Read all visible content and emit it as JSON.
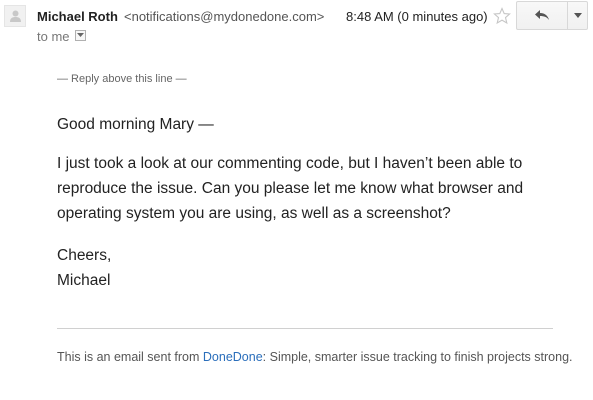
{
  "header": {
    "sender_name": "Michael Roth",
    "sender_email": "<notifications@mydonedone.com>",
    "timestamp": "8:48 AM (0 minutes ago)",
    "recipient_label": "to me"
  },
  "body": {
    "reply_marker": "— Reply above this line —",
    "greeting": "Good morning Mary —",
    "paragraph_lines": [
      "I just took a look at our commenting code, but I haven’t been able to",
      "reproduce the issue. Can you please let me know what browser and",
      "operating system you are using, as well as a screenshot?"
    ],
    "signoff_lines": [
      "Cheers,",
      "Michael"
    ]
  },
  "footer": {
    "prefix": "This is an email sent from ",
    "link_text": "DoneDone",
    "suffix": ": Simple, smarter issue tracking to finish projects strong."
  },
  "icons": {
    "avatar": "person-icon",
    "star": "star-icon",
    "reply": "reply-arrow-icon",
    "more": "chevron-down-icon",
    "details": "dropdown-toggle-icon"
  },
  "colors": {
    "link": "#2a6ebb",
    "star_outline": "#c6c6c6"
  }
}
